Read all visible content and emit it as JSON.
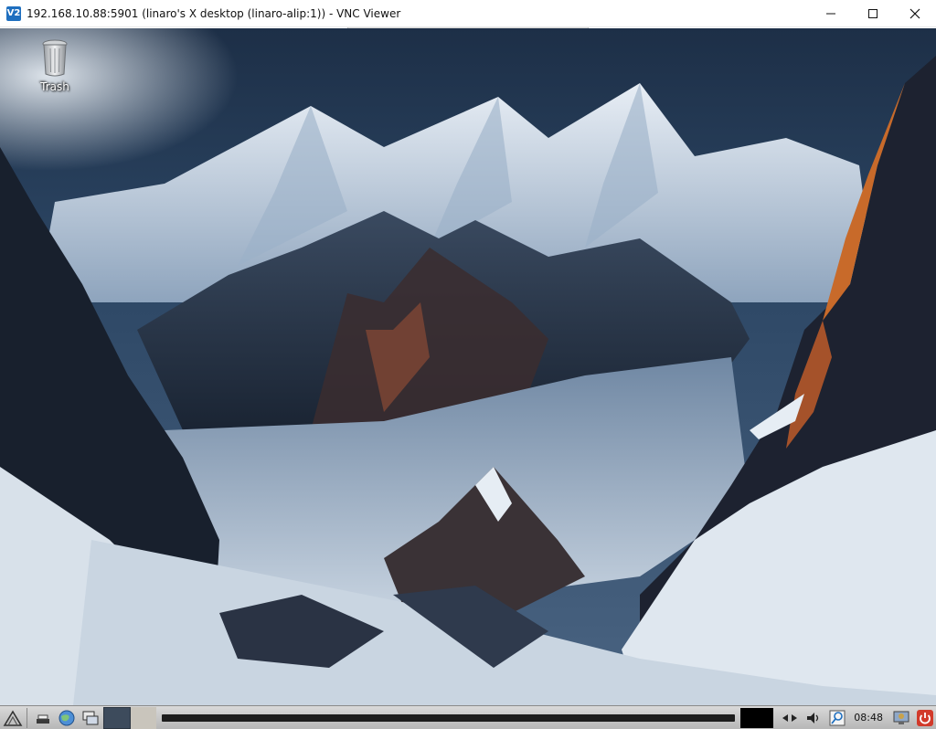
{
  "window": {
    "title": "192.168.10.88:5901 (linaro's X desktop (linaro-alip:1)) - VNC Viewer",
    "app_icon_text": "V2",
    "controls": {
      "minimize": "minimize-icon",
      "maximize": "maximize-icon",
      "close": "close-icon"
    }
  },
  "desktop": {
    "icons": [
      {
        "label": "Trash",
        "icon": "trash-icon"
      }
    ],
    "wallpaper": "mountain-landscape"
  },
  "taskbar": {
    "launchers": [
      {
        "icon": "menu-logo-icon"
      },
      {
        "icon": "show-desktop-icon"
      },
      {
        "icon": "web-browser-icon"
      },
      {
        "icon": "window-list-icon"
      }
    ],
    "tray": [
      {
        "icon": "network-icon"
      },
      {
        "icon": "volume-icon"
      },
      {
        "icon": "search-icon"
      }
    ],
    "clock": "08:48",
    "end_icons": [
      {
        "icon": "user-monitor-icon"
      },
      {
        "icon": "power-icon"
      }
    ]
  },
  "colors": {
    "accent": "#1f6fbf",
    "power": "#d23a2a"
  }
}
